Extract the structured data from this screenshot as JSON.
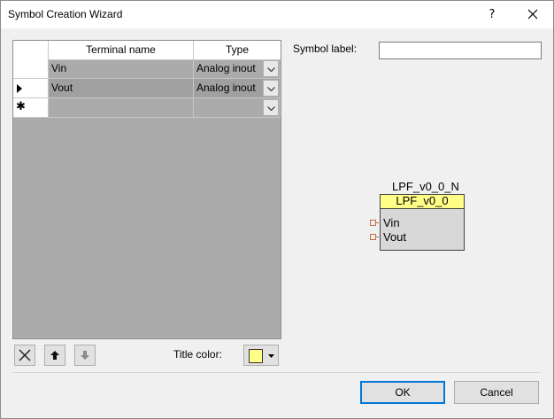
{
  "window": {
    "title": "Symbol Creation Wizard",
    "help_glyph": "?"
  },
  "grid": {
    "columns": [
      "Terminal name",
      "Type"
    ],
    "rows": [
      {
        "name": "Vin",
        "type": "Analog inout",
        "indicator": ""
      },
      {
        "name": "Vout",
        "type": "Analog inout",
        "indicator": "▶",
        "selected": true
      },
      {
        "name": "",
        "type": "",
        "indicator": "✱"
      }
    ]
  },
  "symbol_label": {
    "label": "Symbol label:",
    "value": ""
  },
  "preview": {
    "instance_name": "LPF_v0_0_N",
    "title": "LPF_v0_0",
    "pins": [
      "Vin",
      "Vout"
    ],
    "title_color": "#ffff88"
  },
  "toolbar": {
    "title_color_label": "Title color:"
  },
  "buttons": {
    "ok": "OK",
    "cancel": "Cancel"
  }
}
